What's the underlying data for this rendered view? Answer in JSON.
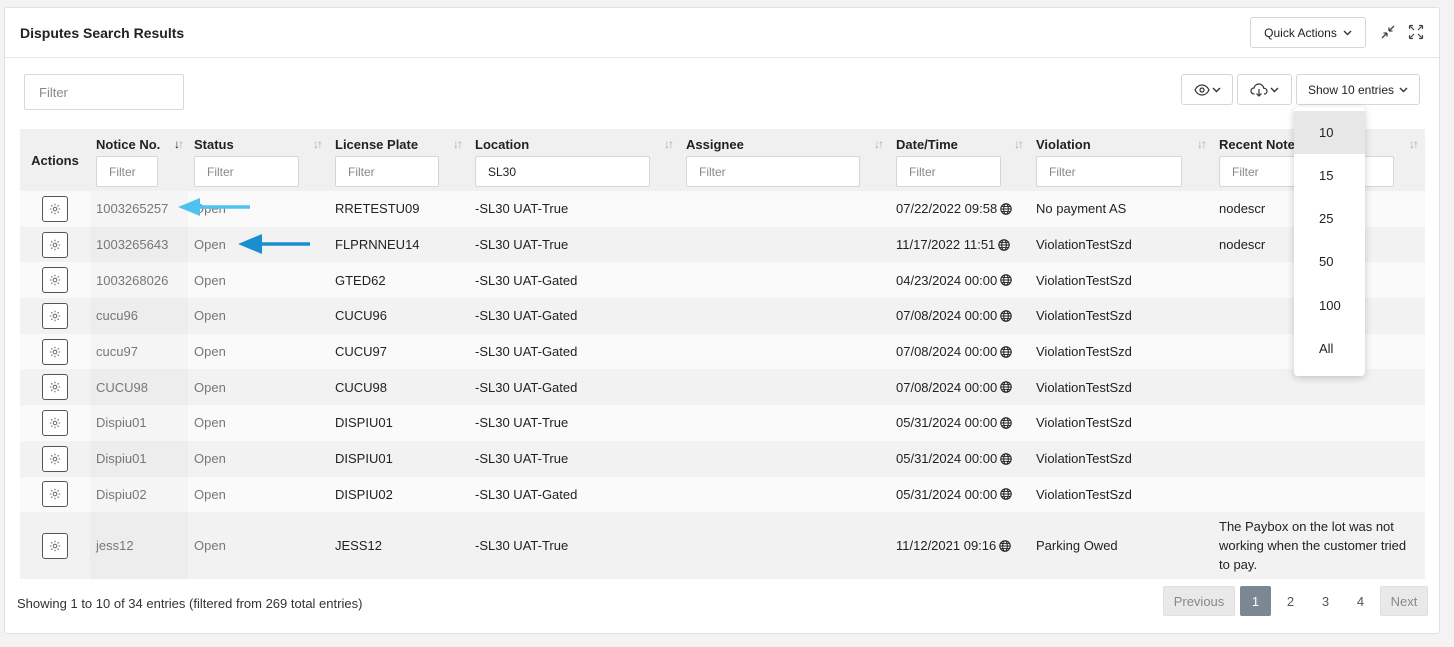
{
  "header": {
    "title": "Disputes Search Results",
    "quick_actions_label": "Quick Actions"
  },
  "toolbar": {
    "filter_placeholder": "Filter",
    "show_entries_label": "Show 10 entries"
  },
  "table": {
    "columns": [
      {
        "label": "Actions"
      },
      {
        "label": "Notice No.",
        "filter_placeholder": "Filter",
        "filter_value": ""
      },
      {
        "label": "Status",
        "filter_placeholder": "Filter",
        "filter_value": ""
      },
      {
        "label": "License Plate",
        "filter_placeholder": "Filter",
        "filter_value": ""
      },
      {
        "label": "Location",
        "filter_placeholder": "Filter",
        "filter_value": "SL30"
      },
      {
        "label": "Assignee",
        "filter_placeholder": "Filter",
        "filter_value": ""
      },
      {
        "label": "Date/Time",
        "filter_placeholder": "Filter",
        "filter_value": ""
      },
      {
        "label": "Violation",
        "filter_placeholder": "Filter",
        "filter_value": ""
      },
      {
        "label": "Recent Note",
        "filter_placeholder": "Filter",
        "filter_value": ""
      }
    ],
    "rows": [
      {
        "notice": "1003265257",
        "status": "Open",
        "plate": "RRETESTU09",
        "location": "-SL30 UAT-True",
        "assignee": "",
        "datetime": "07/22/2022 09:58",
        "violation": "No payment AS",
        "note": "nodescr"
      },
      {
        "notice": "1003265643",
        "status": "Open",
        "plate": "FLPRNNEU14",
        "location": "-SL30 UAT-True",
        "assignee": "",
        "datetime": "11/17/2022 11:51",
        "violation": "ViolationTestSzd",
        "note": "nodescr"
      },
      {
        "notice": "1003268026",
        "status": "Open",
        "plate": "GTED62",
        "location": "-SL30 UAT-Gated",
        "assignee": "",
        "datetime": "04/23/2024 00:00",
        "violation": "ViolationTestSzd",
        "note": ""
      },
      {
        "notice": "cucu96",
        "status": "Open",
        "plate": "CUCU96",
        "location": "-SL30 UAT-Gated",
        "assignee": "",
        "datetime": "07/08/2024 00:00",
        "violation": "ViolationTestSzd",
        "note": ""
      },
      {
        "notice": "cucu97",
        "status": "Open",
        "plate": "CUCU97",
        "location": "-SL30 UAT-Gated",
        "assignee": "",
        "datetime": "07/08/2024 00:00",
        "violation": "ViolationTestSzd",
        "note": ""
      },
      {
        "notice": "CUCU98",
        "status": "Open",
        "plate": "CUCU98",
        "location": "-SL30 UAT-Gated",
        "assignee": "",
        "datetime": "07/08/2024 00:00",
        "violation": "ViolationTestSzd",
        "note": ""
      },
      {
        "notice": "Dispiu01",
        "status": "Open",
        "plate": "DISPIU01",
        "location": "-SL30 UAT-True",
        "assignee": "",
        "datetime": "05/31/2024 00:00",
        "violation": "ViolationTestSzd",
        "note": ""
      },
      {
        "notice": "Dispiu01",
        "status": "Open",
        "plate": "DISPIU01",
        "location": "-SL30 UAT-True",
        "assignee": "",
        "datetime": "05/31/2024 00:00",
        "violation": "ViolationTestSzd",
        "note": ""
      },
      {
        "notice": "Dispiu02",
        "status": "Open",
        "plate": "DISPIU02",
        "location": "-SL30 UAT-Gated",
        "assignee": "",
        "datetime": "05/31/2024 00:00",
        "violation": "ViolationTestSzd",
        "note": ""
      },
      {
        "notice": "jess12",
        "status": "Open",
        "plate": "JESS12",
        "location": "-SL30 UAT-True",
        "assignee": "",
        "datetime": "11/12/2021 09:16",
        "violation": "Parking Owed",
        "note": "The Paybox on the lot was not working when the customer tried to pay."
      }
    ]
  },
  "footer": {
    "info": "Showing 1 to 10 of 34 entries (filtered from 269 total entries)",
    "previous": "Previous",
    "pages": [
      "1",
      "2",
      "3",
      "4"
    ],
    "next": "Next"
  },
  "entries_dropdown": {
    "options": [
      "10",
      "15",
      "25",
      "50",
      "100",
      "All"
    ],
    "selected": "10"
  },
  "icons": {
    "header": [
      "chevron-down-icon",
      "collapse-icon",
      "expand-icon"
    ],
    "toolbar": [
      "eye-icon",
      "cloud-download-icon"
    ],
    "rows": [
      "gear-icon",
      "globe-icon"
    ]
  },
  "colors": {
    "arrow_light": "#4fc3f0",
    "arrow_dark": "#1a8fd0",
    "active_page": "#7d8793"
  }
}
